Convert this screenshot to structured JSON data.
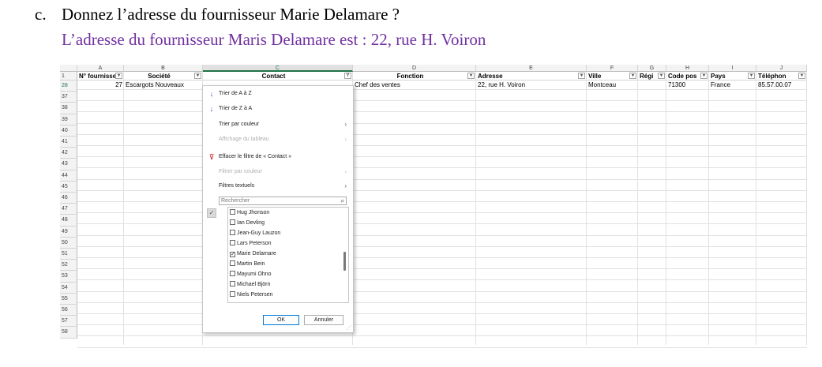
{
  "question": {
    "label": "c.",
    "text": "Donnez l’adresse du fournisseur Marie Delamare ?"
  },
  "answer": "L’adresse du fournisseur Maris Delamare est : 22, rue H. Voiron",
  "sheet": {
    "columns": [
      "A",
      "B",
      "C",
      "D",
      "E",
      "F",
      "G",
      "H",
      "I",
      "J"
    ],
    "headers": [
      "N° fournisse",
      "Société",
      "Contact",
      "Fonction",
      "Adresse",
      "Ville",
      "Régi",
      "Code pos",
      "Pays",
      "Téléphon"
    ],
    "row_numbers": [
      "1",
      "28",
      "37",
      "38",
      "39",
      "40",
      "41",
      "42",
      "43",
      "44",
      "45",
      "46",
      "47",
      "48",
      "49",
      "50",
      "51",
      "52",
      "53",
      "54",
      "55",
      "56",
      "57",
      "58"
    ],
    "data_row": [
      "27",
      "Escargots Nouveaux",
      "",
      "Chef des ventes",
      "22, rue H. Voiron",
      "Montceau",
      "",
      "71300",
      "France",
      "85.57.00.07"
    ],
    "filter_symbol": "▾",
    "active_filter_symbol": "▾Y"
  },
  "filter_menu": {
    "sort_asc": "Trier de A à Z",
    "sort_desc": "Trier de Z à A",
    "sort_color": "Trier par couleur",
    "sheet_view": "Affichage du tableau",
    "clear_filter": "Effacer le filtre de « Contact »",
    "filter_color": "Filtrer par couleur",
    "text_filters": "Filtres textuels",
    "search_placeholder": "Rechercher",
    "items": [
      {
        "label": "Hug Jhonson",
        "checked": false
      },
      {
        "label": "Ian Devling",
        "checked": false
      },
      {
        "label": "Jean-Guy Lauzon",
        "checked": false
      },
      {
        "label": "Lars Peterson",
        "checked": false
      },
      {
        "label": "Marie Delamare",
        "checked": true
      },
      {
        "label": "Martin Bein",
        "checked": false
      },
      {
        "label": "Mayumi Ohno",
        "checked": false
      },
      {
        "label": "Michael Björn",
        "checked": false
      },
      {
        "label": "Niels Petersen",
        "checked": false
      }
    ],
    "ok": "OK",
    "cancel": "Annuler"
  },
  "colors": {
    "answer": "#7030a0",
    "excel_green": "#217346",
    "accent_blue": "#2b579a"
  }
}
